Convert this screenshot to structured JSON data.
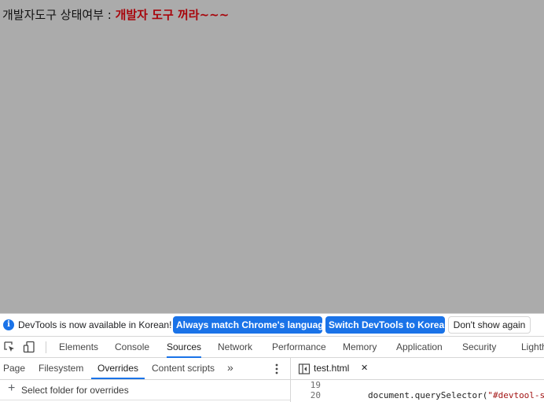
{
  "page": {
    "status_label": "개발자도구 상태여부 : ",
    "status_value": "개발자 도구 꺼라~~~"
  },
  "devtools": {
    "infobar": {
      "icon": "info-icon",
      "message": "DevTools is now available in Korean!",
      "buttons": [
        {
          "label": "Always match Chrome's language"
        },
        {
          "label": "Switch DevTools to Korean"
        },
        {
          "label": "Don't show again"
        }
      ]
    },
    "toolbar_icons": [
      "inspect-element-icon",
      "device-toolbar-icon"
    ],
    "main_tabs": [
      {
        "label": "Elements"
      },
      {
        "label": "Console"
      },
      {
        "label": "Sources",
        "active": true
      },
      {
        "label": "Network"
      },
      {
        "label": "Performance"
      },
      {
        "label": "Memory"
      },
      {
        "label": "Application"
      },
      {
        "label": "Security"
      },
      {
        "label": "Lighth"
      }
    ],
    "sources": {
      "navigator_tabs": [
        {
          "label": "Page"
        },
        {
          "label": "Filesystem"
        },
        {
          "label": "Overrides",
          "active": true
        },
        {
          "label": "Content scripts"
        }
      ],
      "more_tabs_icon": "»",
      "select_folder_label": "Select folder for overrides",
      "open_file": "test.html",
      "close_icon": "✕",
      "code_lines": [
        {
          "number": "19",
          "text": ""
        },
        {
          "number": "20",
          "prefix": "document.querySelector(",
          "string": "\"#devtool-s"
        }
      ]
    }
  },
  "colors": {
    "page_background": "#ababab",
    "status_value": "#a8050b",
    "accent": "#1a73e8"
  }
}
